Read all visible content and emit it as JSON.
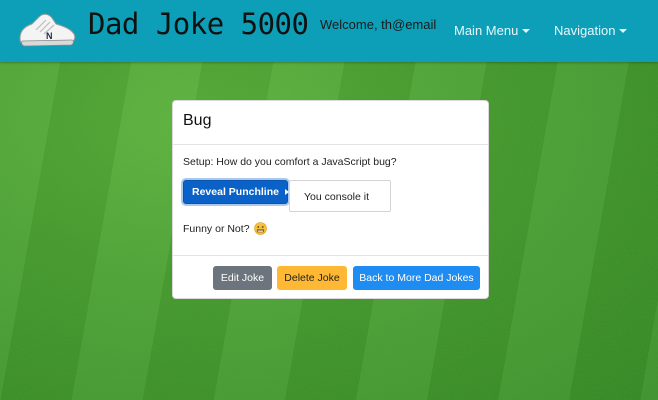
{
  "app": {
    "title": "Dad Joke 5000",
    "welcome": "Welcome, th@email",
    "logo_icon": "sneaker-icon"
  },
  "nav": {
    "main_menu": "Main Menu",
    "navigation": "Navigation"
  },
  "joke": {
    "title": "Bug",
    "setup": "Setup: How do you comfort a JavaScript bug?",
    "reveal_label": "Reveal Punchline",
    "punchline": "You console it",
    "rating_prompt": "Funny or Not?",
    "rating_icon": "grimace-emoji-icon"
  },
  "actions": {
    "edit": "Edit Joke",
    "delete": "Delete Joke",
    "back": "Back to More Dad Jokes"
  },
  "colors": {
    "navbar": "#0d9fb8",
    "primary": "#0a62c9",
    "secondary": "#6c757d",
    "warning": "#ffb833",
    "info": "#1f8cf2"
  }
}
